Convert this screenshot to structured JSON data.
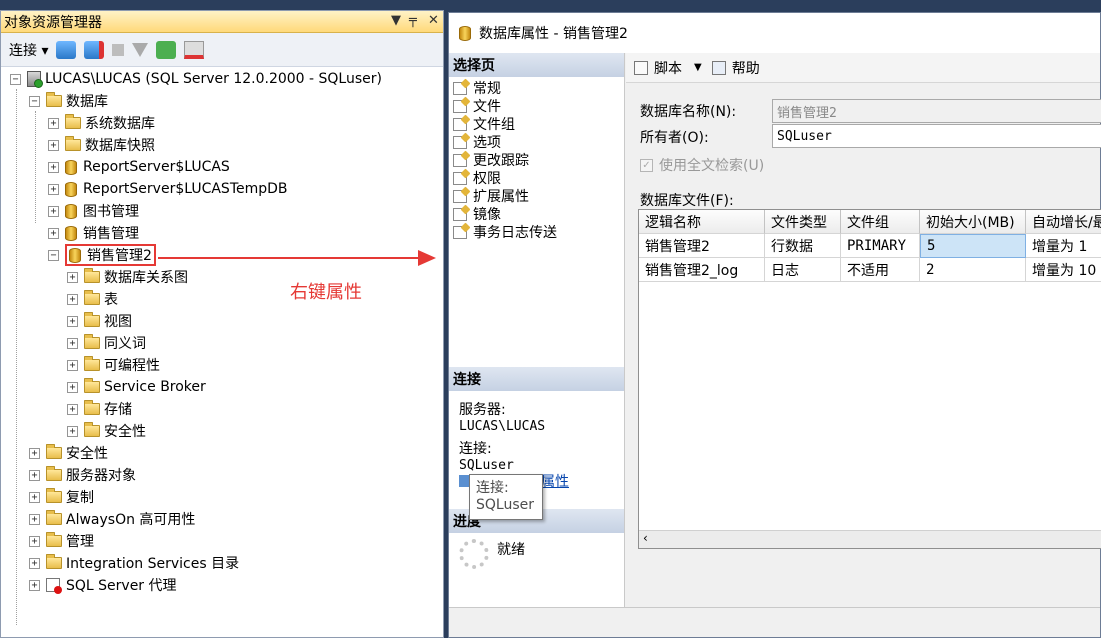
{
  "object_explorer": {
    "title": "对象资源管理器",
    "title_controls": [
      "▼",
      "╤",
      "✕"
    ],
    "toolbar": {
      "connect_label": "连接 ▾"
    },
    "tree": [
      {
        "label": "LUCAS\\LUCAS (SQL Server 12.0.2000 - SQLuser)",
        "icon": "server-icon",
        "expander": "−"
      },
      {
        "label": "数据库",
        "icon": "folder-icon",
        "expander": "−"
      },
      {
        "label": "系统数据库",
        "icon": "folder-icon",
        "expander": "+"
      },
      {
        "label": "数据库快照",
        "icon": "folder-icon",
        "expander": "+"
      },
      {
        "label": "ReportServer$LUCAS",
        "icon": "database-icon",
        "expander": "+"
      },
      {
        "label": "ReportServer$LUCASTempDB",
        "icon": "database-icon",
        "expander": "+"
      },
      {
        "label": "图书管理",
        "icon": "database-icon",
        "expander": "+"
      },
      {
        "label": "销售管理",
        "icon": "database-icon",
        "expander": "+"
      },
      {
        "label": "销售管理2",
        "icon": "database-icon",
        "expander": "−",
        "highlighted": true
      },
      {
        "label": "数据库关系图",
        "icon": "folder-icon",
        "expander": "+"
      },
      {
        "label": "表",
        "icon": "folder-icon",
        "expander": "+"
      },
      {
        "label": "视图",
        "icon": "folder-icon",
        "expander": "+"
      },
      {
        "label": "同义词",
        "icon": "folder-icon",
        "expander": "+"
      },
      {
        "label": "可编程性",
        "icon": "folder-icon",
        "expander": "+"
      },
      {
        "label": "Service Broker",
        "icon": "folder-icon",
        "expander": "+"
      },
      {
        "label": "存储",
        "icon": "folder-icon",
        "expander": "+"
      },
      {
        "label": "安全性",
        "icon": "folder-icon",
        "expander": "+"
      },
      {
        "label": "安全性",
        "icon": "folder-icon",
        "expander": "+"
      },
      {
        "label": "服务器对象",
        "icon": "folder-icon",
        "expander": "+"
      },
      {
        "label": "复制",
        "icon": "folder-icon",
        "expander": "+"
      },
      {
        "label": "AlwaysOn 高可用性",
        "icon": "folder-icon",
        "expander": "+"
      },
      {
        "label": "管理",
        "icon": "folder-icon",
        "expander": "+"
      },
      {
        "label": "Integration Services 目录",
        "icon": "folder-icon",
        "expander": "+"
      },
      {
        "label": "SQL Server 代理",
        "icon": "agent-icon",
        "expander": "+"
      }
    ]
  },
  "annotation": {
    "text": "右键属性",
    "color": "#e53935"
  },
  "dialog": {
    "title": "数据库属性 - 销售管理2",
    "select_page_header": "选择页",
    "pages": [
      "常规",
      "文件",
      "文件组",
      "选项",
      "更改跟踪",
      "权限",
      "扩展属性",
      "镜像",
      "事务日志传送"
    ],
    "connection_header": "连接",
    "server_label": "服务器:",
    "server_value": "LUCAS\\LUCAS",
    "connection_label": "连接:",
    "connection_value": "SQLuser",
    "view_connection_link": "属性",
    "tooltip_title": "连接:",
    "tooltip_value": "SQLuser",
    "progress_header": "进度",
    "progress_status": "就绪",
    "toolbar": {
      "script_label": "脚本",
      "help_label": "帮助"
    },
    "db_name_label": "数据库名称(N):",
    "db_name_value": "销售管理2",
    "owner_label": "所有者(O):",
    "owner_value": "SQLuser",
    "fulltext_label": "使用全文检索(U)",
    "files_label": "数据库文件(F):",
    "grid": {
      "headers": [
        "逻辑名称",
        "文件类型",
        "文件组",
        "初始大小(MB)",
        "自动增长/最"
      ],
      "rows": [
        [
          "销售管理2",
          "行数据",
          "PRIMARY",
          "5",
          "增量为 1"
        ],
        [
          "销售管理2_log",
          "日志",
          "不适用",
          "2",
          "增量为 10"
        ]
      ]
    }
  }
}
